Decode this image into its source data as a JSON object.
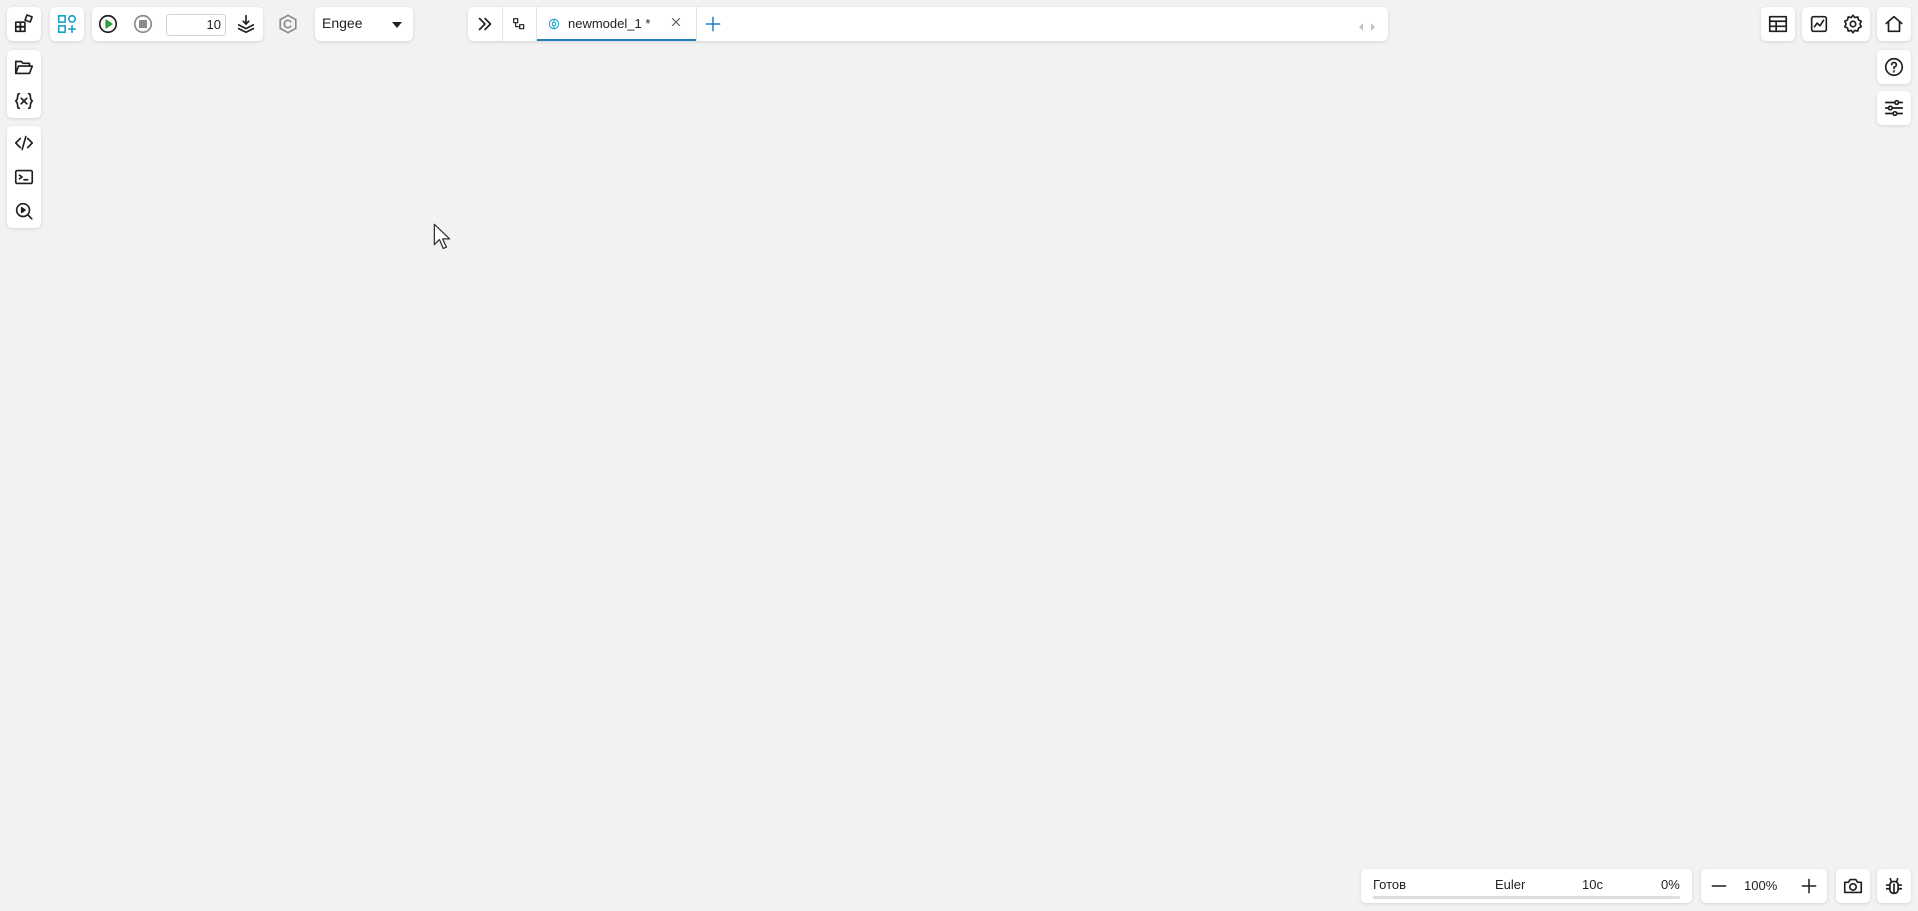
{
  "toolbar": {
    "steps_value": "10",
    "solver_target": "Engee"
  },
  "tabs": [
    {
      "label": "newmodel_1 *",
      "active": true
    }
  ],
  "status": {
    "state": "Готов",
    "solver": "Euler",
    "time": "10с",
    "progress": "0%",
    "progress_fraction": 0
  },
  "zoom": {
    "level": "100%"
  },
  "colors": {
    "accent": "#1e7fc2",
    "teal": "#1aa3c8",
    "run_green": "#2e9e3e",
    "background": "#f2f2f2"
  }
}
